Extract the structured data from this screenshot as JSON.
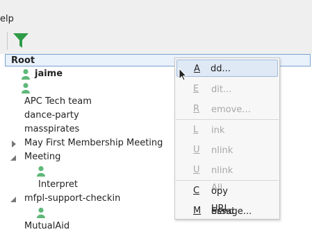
{
  "menubar": {
    "help_label": "elp"
  },
  "toolbar": {
    "filter_icon": "funnel-icon",
    "filter_color": "#2e9b47"
  },
  "tree": {
    "root_label": "Root",
    "items": [
      {
        "label": "jaime",
        "bold": true,
        "icon": "user-icon"
      },
      {
        "label": "",
        "icon": "user-icon"
      },
      {
        "label": "APC Tech team"
      },
      {
        "label": "dance-party"
      },
      {
        "label": "masspirates"
      },
      {
        "label": "May First Membership Meeting",
        "expander": "collapsed"
      },
      {
        "label": "Meeting",
        "expander": "expanded"
      },
      {
        "label": "",
        "icon": "user-icon"
      },
      {
        "label": "Interpret"
      },
      {
        "label": "mfpl-support-checkin",
        "expander": "expanded"
      },
      {
        "label": "",
        "icon": "user-icon"
      },
      {
        "label": "MutualAid"
      }
    ]
  },
  "context_menu": {
    "items": [
      {
        "pre": "",
        "ul": "A",
        "post": "dd...",
        "enabled": true,
        "highlighted": true
      },
      {
        "pre": "",
        "ul": "E",
        "post": "dit...",
        "enabled": false
      },
      {
        "pre": "",
        "ul": "R",
        "post": "emove...",
        "enabled": false
      },
      {
        "pre": "",
        "ul": "L",
        "post": "ink",
        "enabled": false
      },
      {
        "pre": "",
        "ul": "U",
        "post": "nlink",
        "enabled": false
      },
      {
        "pre": "",
        "ul": "U",
        "post": "nlink All",
        "enabled": false
      },
      {
        "pre": "",
        "ul": "C",
        "post": "opy URL",
        "enabled": true
      },
      {
        "pre": "Send ",
        "ul": "M",
        "post": "essage...",
        "enabled": true
      }
    ]
  },
  "colors": {
    "user_icon": "#5fb87a",
    "selection_border": "#7aa3cf"
  }
}
